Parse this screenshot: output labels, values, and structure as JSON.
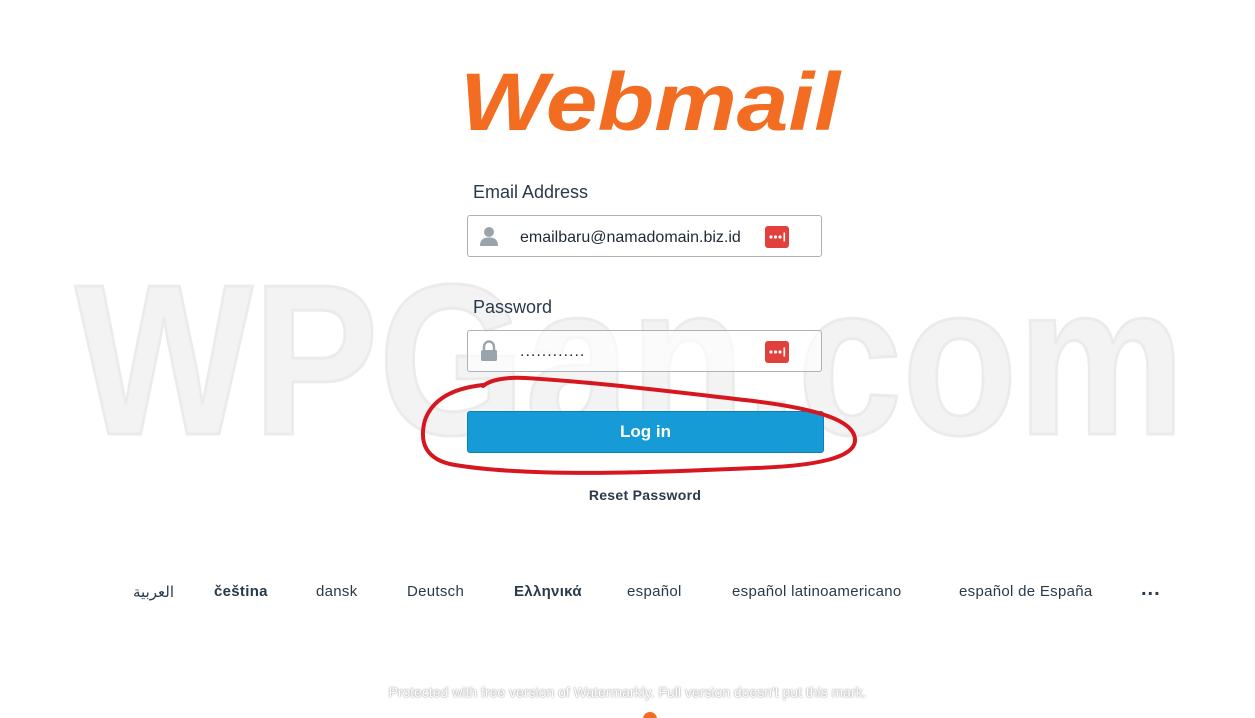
{
  "brand": {
    "logo_text": "Webmail",
    "color": "#f26c22"
  },
  "watermark": {
    "text": "WPGan.com"
  },
  "email": {
    "label": "Email Address",
    "value": "emailbaru@namadomain.biz.id",
    "icon": "user-icon"
  },
  "password": {
    "label": "Password",
    "value": "............",
    "icon": "lock-icon"
  },
  "password_manager_icon": "password-manager-icon",
  "login_button": {
    "label": "Log in",
    "color": "#179bd7"
  },
  "reset_password": {
    "label": "Reset Password"
  },
  "languages": [
    "العربية",
    "čeština",
    "dansk",
    "Deutsch",
    "Ελληνικά",
    "español",
    "español latinoamericano",
    "español de España"
  ],
  "more_languages": "...",
  "footer_note": "Protected with free version of Watermarkly. Full version doesn't put this mark.",
  "annotation_color": "#d7171f"
}
